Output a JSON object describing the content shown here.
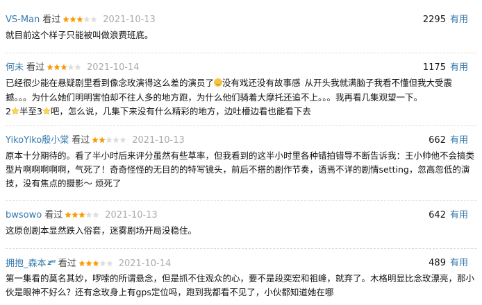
{
  "colors": {
    "link": "#3377aa",
    "star_filled": "#f99b01",
    "star_empty": "#dddddd",
    "date": "#aaaaaa"
  },
  "comments": [
    {
      "user": "VS-Man",
      "status": "看过",
      "rating": 3,
      "date": "2021-10-13",
      "votes": "2295",
      "vote_label": "有用",
      "text": "就目前这个样子只能被叫做浪费班底。"
    },
    {
      "user": "何未",
      "status": "看过",
      "rating": 3,
      "date": "2021-10-14",
      "votes": "1175",
      "vote_label": "有用",
      "text_part1": "已经很少能在悬疑剧里看到像念玫演得这么差的演员了",
      "text_part2": "没有戏还没有故事感",
      "text_part3": "从开头我就满脑子我看不懂但我大受震撼。。。为什么她们明明害怕却不往人多的地方跑，为什么他们骑着大摩托还追不上。。。我再看几集观望一下。",
      "text_part4": "2",
      "text_part5": "半至3",
      "text_part6": "吧，怎么说，几集下来没有什么精彩的地方，边吐槽边看也能看下去"
    },
    {
      "user": "YikoYiko殷小棠",
      "status": "看过",
      "rating": 2,
      "date": "2021-10-13",
      "votes": "662",
      "vote_label": "有用",
      "text": "原本十分期待的。看了半小时后来评分虽然有些草率，但我看到的这半小时里各种错拍错导不断告诉我：王小帅他不会搞类型片啊啊啊啊啊，气死了！奇奇怪怪的无目的的特写镜头，前后不搭的剧作节奏，语焉不详的剧情setting，忽高忽低的演技，没有焦点的摄影～ 烦死了"
    },
    {
      "user": "bwsowo",
      "status": "看过",
      "rating": 3,
      "date": "2021-10-13",
      "votes": "642",
      "vote_label": "有用",
      "text": "这原创剧本显然跌入俗套，迷雾剧场开局没稳住。"
    },
    {
      "user": "拥抱_森本",
      "status": "看过",
      "rating": 3,
      "date": "2021-10-14",
      "votes": "489",
      "vote_label": "有用",
      "text": "第一集看的莫名其妙，啰嗦的所谓悬念，但是抓不住观众的心，要不是段奕宏和祖峰，就弃了。木格明显比念玫漂亮，那小伙是眼神不好么？还有念玫身上有gps定位吗，跑到我都看不见了，小伙都知道她在哪"
    }
  ]
}
